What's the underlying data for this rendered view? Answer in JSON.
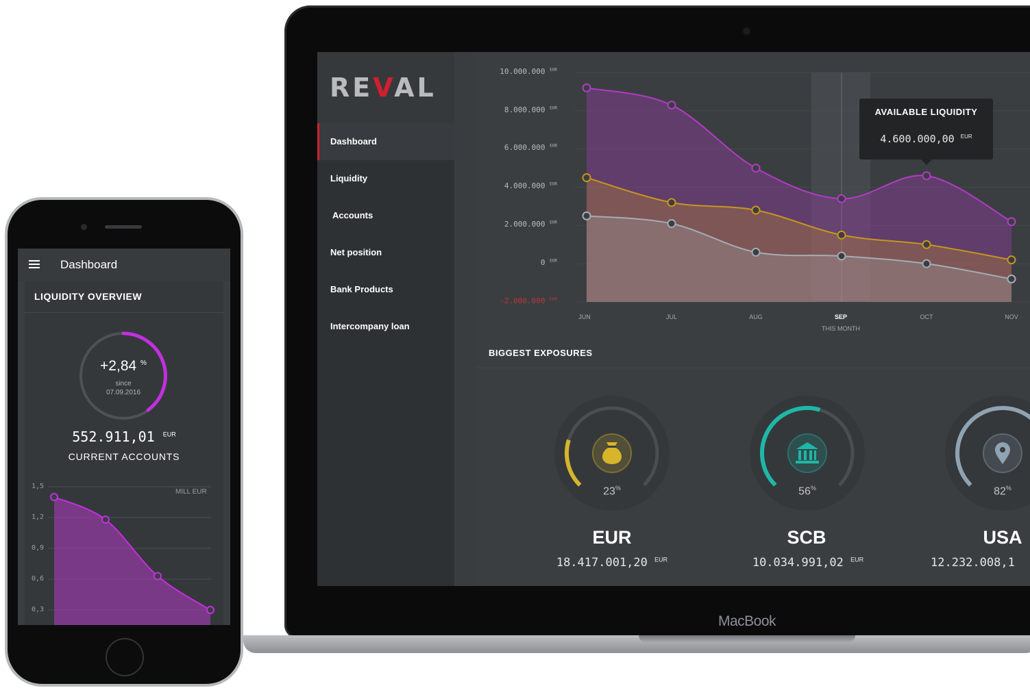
{
  "laptop": {
    "brand": "MacBook",
    "logo": {
      "text_left": "RE",
      "text_tick": "V",
      "text_right": "AL"
    },
    "sidebar": {
      "items": [
        {
          "label": "Dashboard",
          "active": true
        },
        {
          "label": "Liquidity"
        },
        {
          "label": "Accounts"
        },
        {
          "label": "Net position"
        },
        {
          "label": "Bank Products"
        },
        {
          "label": "Intercompany loan"
        }
      ]
    },
    "chart": {
      "y_ticks": [
        "10.000.000",
        "8.000.000",
        "6.000.000",
        "4.000.000",
        "2.000.000",
        "0",
        "-2.000.000"
      ],
      "y_unit": "EUR",
      "x_ticks": [
        "JUN",
        "JUL",
        "AUG",
        "SEP",
        "OCT",
        "NOV"
      ],
      "x_current_label": "THIS MONTH",
      "tooltip": {
        "title": "AVAILABLE LIQUIDITY",
        "value": "4.600.000,00",
        "unit": "EUR"
      }
    },
    "exposures": {
      "title": "BIGGEST EXPOSURES",
      "items": [
        {
          "name": "EUR",
          "value": "18.417.001,20",
          "unit": "EUR",
          "pct": "23",
          "icon": "money-bag-icon",
          "color": "#d6b52b"
        },
        {
          "name": "SCB",
          "value": "10.034.991,02",
          "unit": "EUR",
          "pct": "56",
          "icon": "bank-icon",
          "color": "#1db8a7"
        },
        {
          "name": "USA",
          "value": "12.232.008,1",
          "unit": "",
          "pct": "82",
          "icon": "location-pin-icon",
          "color": "#8fa3b2"
        }
      ]
    }
  },
  "phone": {
    "title": "Dashboard",
    "card_title": "LIQUIDITY OVERVIEW",
    "change": "+2,84",
    "change_unit": "%",
    "since_label": "since",
    "since_date": "07.09.2016",
    "amount": "552.911,01",
    "amount_unit": "EUR",
    "amount_label": "CURRENT ACCOUNTS",
    "chart_unit": "MILL EUR",
    "y_ticks": [
      "1,5",
      "1,2",
      "0,9",
      "0,6",
      "0,3"
    ]
  },
  "chart_data": [
    {
      "type": "area",
      "x": [
        "JUN",
        "JUL",
        "AUG",
        "SEP",
        "OCT",
        "NOV"
      ],
      "ylim": [
        -2000000,
        10000000
      ],
      "series": [
        {
          "color": "#b23bc4",
          "values": [
            9200000,
            8300000,
            5000000,
            3400000,
            4600000,
            2200000
          ]
        },
        {
          "color": "#c8961e",
          "values": [
            4500000,
            3200000,
            2800000,
            1500000,
            1000000,
            200000
          ]
        },
        {
          "color": "#a4adb5",
          "values": [
            2500000,
            2100000,
            600000,
            400000,
            0,
            -800000
          ]
        }
      ]
    },
    {
      "type": "area",
      "ylim": [
        0.3,
        1.5
      ],
      "series": [
        {
          "color": "#b23bc4",
          "values": [
            1.4,
            1.18,
            0.63,
            0.3
          ]
        }
      ]
    }
  ],
  "colors": {
    "accent_red": "#d0202e",
    "purple": "#b23bc4",
    "gold": "#c8961e",
    "grey": "#a4adb5"
  }
}
